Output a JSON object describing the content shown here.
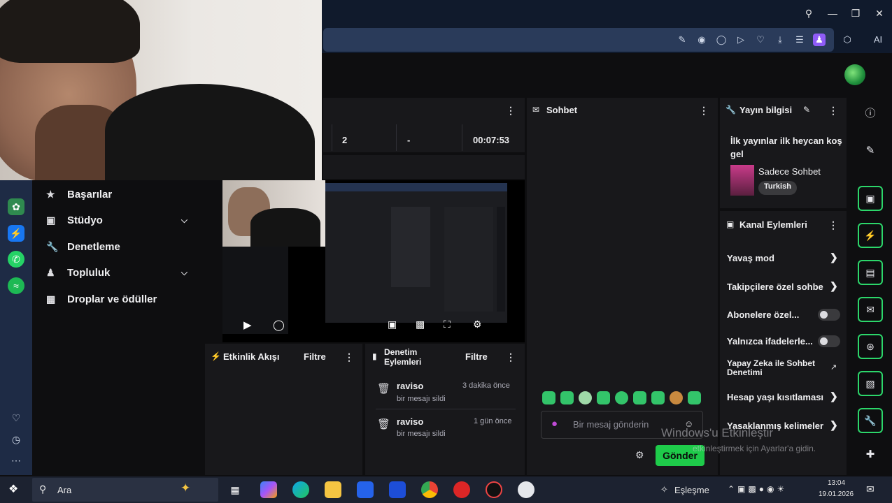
{
  "topbar": {
    "icons": [
      "edit-icon",
      "camera-icon",
      "shield-icon",
      "play-icon",
      "heart-icon",
      "download-icon",
      "menu-icon",
      "user-icon",
      "box-icon",
      "ai-icon"
    ],
    "ai_label": "AI"
  },
  "nav": {
    "items": [
      {
        "label": "Başarılar",
        "icon": "trophy-icon",
        "chevron": false
      },
      {
        "label": "Stüdyo",
        "icon": "studio-icon",
        "chevron": true
      },
      {
        "label": "Denetleme",
        "icon": "wrench-icon",
        "chevron": false
      },
      {
        "label": "Topluluk",
        "icon": "people-icon",
        "chevron": true
      },
      {
        "label": "Droplar ve ödüller",
        "icon": "gift-icon",
        "chevron": false
      }
    ]
  },
  "stats": {
    "values": [
      "2",
      "-",
      "00:07:53"
    ]
  },
  "activity_feed": {
    "title": "Etkinlik Akışı",
    "filter": "Filtre"
  },
  "mod_actions": {
    "title": "Denetim Eylemleri",
    "filter": "Filtre",
    "rows": [
      {
        "user": "raviso",
        "action": "bir mesajı sildi",
        "time": "3 dakika önce"
      },
      {
        "user": "raviso",
        "action": "bir mesajı sildi",
        "time": "1 gün önce"
      }
    ]
  },
  "chat": {
    "title": "Sohbet",
    "placeholder": "Bir mesaj gönderin",
    "send_label": "Gönder"
  },
  "stream_info": {
    "title": "Yayın bilgisi",
    "stream_title": "İlk yayınlar ilk heycan koş gel",
    "category": "Sadece Sohbet",
    "tag": "Turkish"
  },
  "channel_actions": {
    "title": "Kanal Eylemleri",
    "rows": [
      {
        "label": "Yavaş mod",
        "control": "chevron"
      },
      {
        "label": "Takipçilere özel sohbe",
        "control": "chevron"
      },
      {
        "label": "Abonelere özel...",
        "control": "toggle"
      },
      {
        "label": "Yalnızca ifadelerle...",
        "control": "toggle"
      },
      {
        "label": "Yapay Zeka ile Sohbet Denetimi",
        "control": "external"
      },
      {
        "label": "Hesap yaşı kısıtlaması",
        "control": "chevron"
      },
      {
        "label": "Yasaklanmış kelimeler",
        "control": "chevron"
      }
    ]
  },
  "watermark": {
    "line1": "Windows'u Etkinleştir",
    "line2": "etkinleştirmek için Ayarlar'a gidin."
  },
  "taskbar": {
    "search_label": "Ara",
    "status": "Eşleşme",
    "time": "13:04",
    "date": "19.01.2026"
  }
}
